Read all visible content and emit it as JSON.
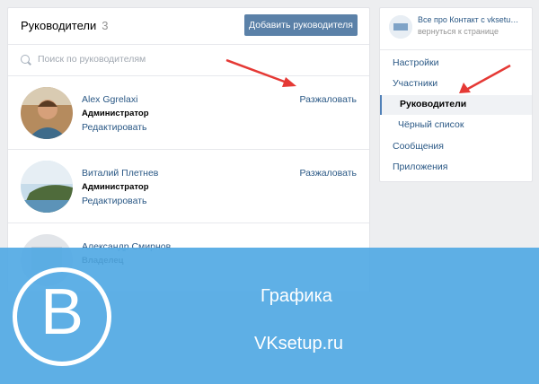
{
  "header": {
    "title": "Руководители",
    "count": "3",
    "add_button": "Добавить руководителя"
  },
  "search": {
    "placeholder": "Поиск по руководителям"
  },
  "managers": [
    {
      "name": "Alex Ggrelaxi",
      "role": "Администратор",
      "edit": "Редактировать",
      "action": "Разжаловать"
    },
    {
      "name": "Виталий Плетнев",
      "role": "Администратор",
      "edit": "Редактировать",
      "action": "Разжаловать"
    },
    {
      "name": "Александр Смирнов",
      "role": "Владелец"
    }
  ],
  "sidebar": {
    "group_name": "Все про Контакт с vksetu…",
    "back_link": "вернуться к странице",
    "menu": [
      "Настройки",
      "Участники",
      "Руководители",
      "Чёрный список",
      "Сообщения",
      "Приложения"
    ]
  },
  "overlay": {
    "logo_letter": "B",
    "title": "Графика",
    "url": "VKsetup.ru"
  },
  "colors": {
    "accent": "#5b81a8",
    "link": "#2a5885",
    "overlay": "#53aae4",
    "arrow": "#e53935"
  }
}
